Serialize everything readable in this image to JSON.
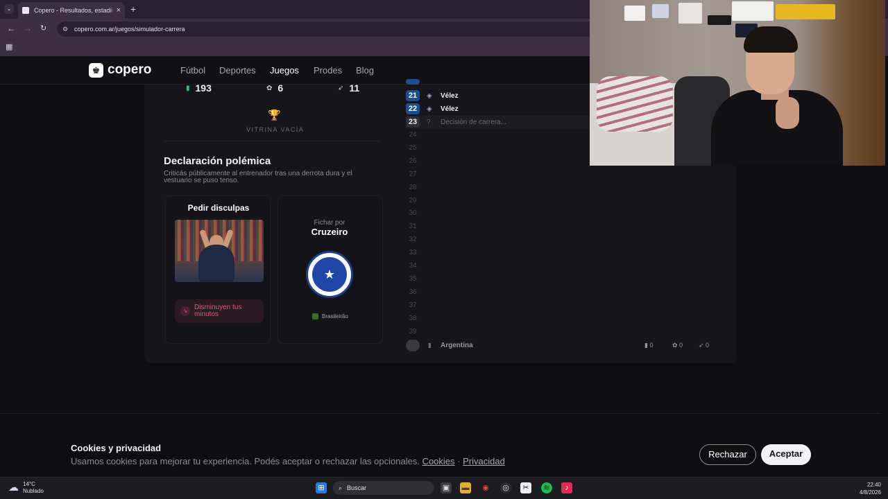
{
  "browser": {
    "tab_title": "Copero - Resultados, estadísticas",
    "tab_close": "×",
    "new_tab": "+",
    "url": "copero.com.ar/juegos/simulador-carrera"
  },
  "site": {
    "logo": "copero",
    "nav": [
      "Fútbol",
      "Deportes",
      "Juegos",
      "Prodes",
      "Blog"
    ],
    "active_nav": "Juegos"
  },
  "stats": [
    {
      "icon": "▮",
      "value": "193"
    },
    {
      "icon": "✿",
      "value": "6"
    },
    {
      "icon": "➶",
      "value": "11"
    }
  ],
  "vitrina": "VITRINA VACÍA",
  "event": {
    "title": "Declaración polémica",
    "description": "Criticás públicamente al entrenador tras una derrota dura y el vestuario se puso tenso."
  },
  "option1": {
    "title": "Pedir disculpas",
    "effect": "Disminuyen tus minutos"
  },
  "option2": {
    "prefix": "Fichar por",
    "club": "Cruzeiro",
    "league": "Brasileirão"
  },
  "career": {
    "rows": [
      {
        "n": "21",
        "team": "Vélez"
      },
      {
        "n": "22",
        "team": "Vélez"
      }
    ],
    "current": {
      "n": "23",
      "label": "Decisión de carrera..."
    },
    "future": [
      "24",
      "25",
      "26",
      "27",
      "28",
      "29",
      "30",
      "31",
      "32",
      "33",
      "34",
      "35",
      "36",
      "37",
      "38",
      "39"
    ],
    "footer": {
      "country": "Argentina",
      "stat1": "0",
      "stat2": "0",
      "stat3": "0"
    }
  },
  "cookies": {
    "title": "Cookies y privacidad",
    "text": "Usamos cookies para mejorar tu experiencia. Podés aceptar o rechazar las opcionales.",
    "link1": "Cookies",
    "sep": "·",
    "link2": "Privacidad",
    "reject": "Rechazar",
    "accept": "Aceptar"
  },
  "taskbar": {
    "temp": "14°C",
    "weather": "Nublado",
    "search": "Buscar",
    "time": "22:40",
    "date": "4/8/2026"
  },
  "colors": {
    "accent_blue": "#1d4f8c",
    "negative": "#e0567f"
  }
}
